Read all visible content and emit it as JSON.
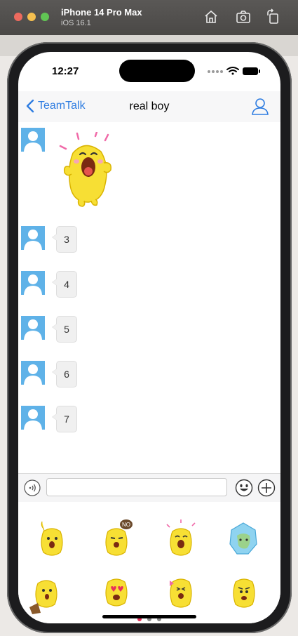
{
  "simulator": {
    "device_name": "iPhone 14 Pro Max",
    "os_version": "iOS 16.1"
  },
  "status_bar": {
    "time": "12:27"
  },
  "nav": {
    "back_label": "TeamTalk",
    "title": "real boy"
  },
  "messages": [
    {
      "type": "sticker",
      "sticker_icon": "yellow-monster-laughing-sticker"
    },
    {
      "type": "text",
      "text": "3"
    },
    {
      "type": "text",
      "text": "4"
    },
    {
      "type": "text",
      "text": "5"
    },
    {
      "type": "text",
      "text": "6"
    },
    {
      "type": "text",
      "text": "7"
    }
  ],
  "input": {
    "value": "",
    "placeholder": ""
  },
  "sticker_panel": {
    "stickers": [
      "waving-sticker",
      "no-bubble-sticker",
      "excited-sticker",
      "crystal-sticker",
      "sitting-sticker",
      "heart-eyes-sticker",
      "bow-sticker",
      "worried-sticker"
    ],
    "pages": 3,
    "active_page": 1
  },
  "colors": {
    "accent": "#2f7de1",
    "avatar": "#5fb2e8",
    "active_dot": "#e8305a"
  }
}
